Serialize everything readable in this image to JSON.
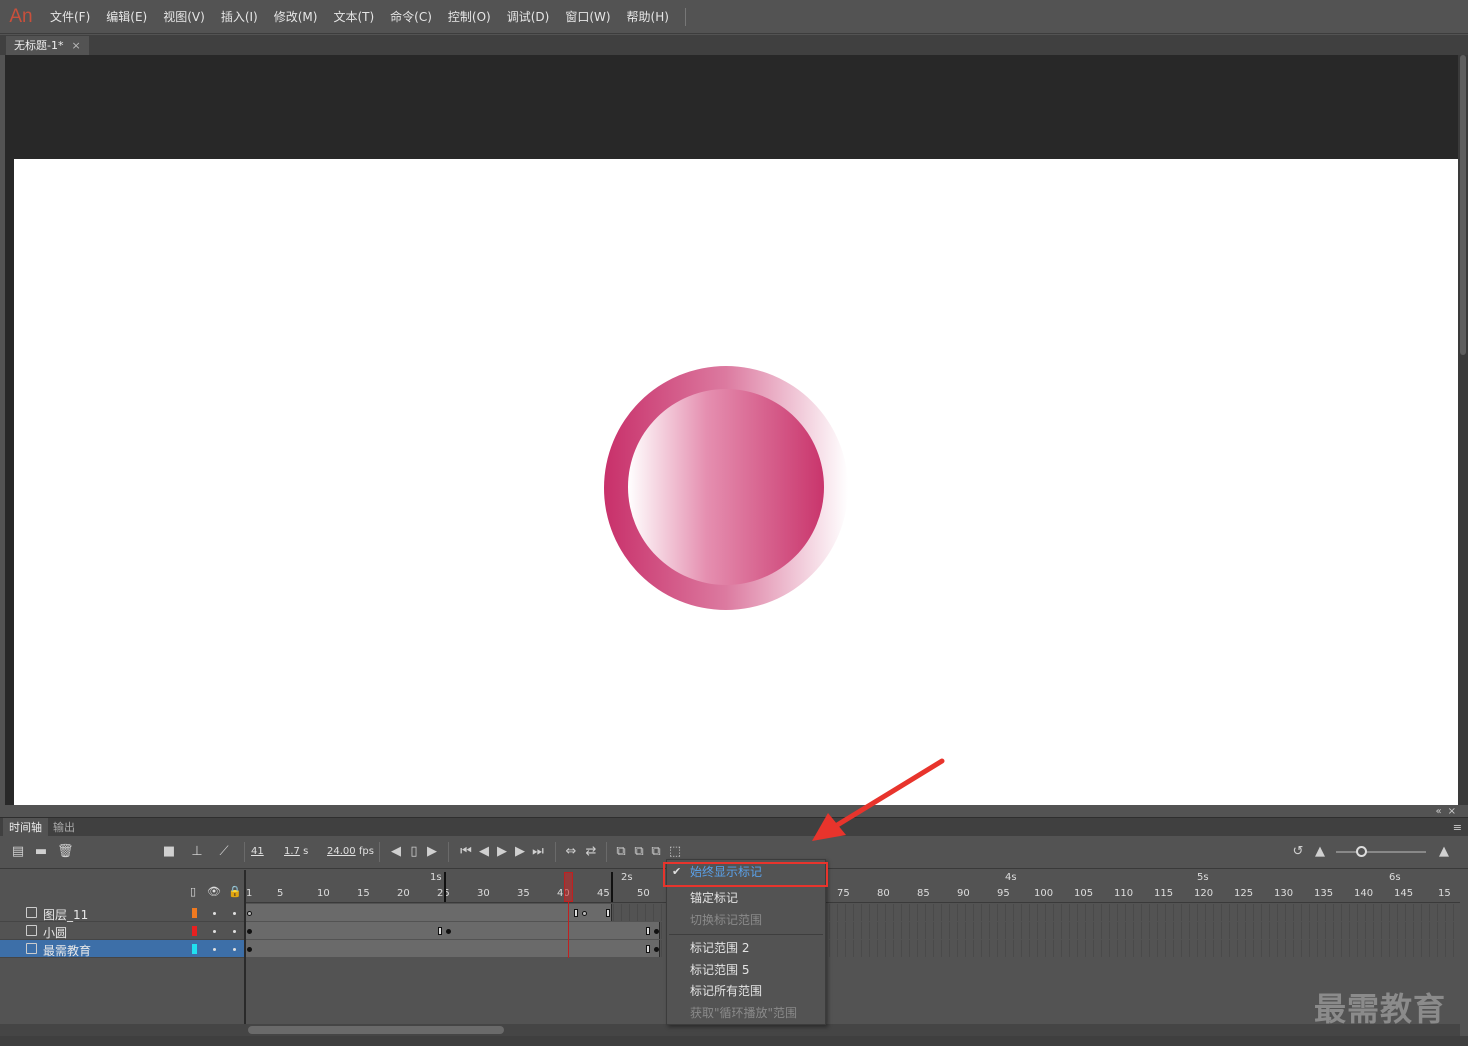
{
  "app": {
    "logo": "An",
    "menu": [
      "文件(F)",
      "编辑(E)",
      "视图(V)",
      "插入(I)",
      "修改(M)",
      "文本(T)",
      "命令(C)",
      "控制(O)",
      "调试(D)",
      "窗口(W)",
      "帮助(H)"
    ],
    "document_tab": "无标题-1*",
    "close_glyph": "×"
  },
  "colors": {
    "ring_gradient": [
      "#c8306a",
      "#dc7aa0",
      "#ffffff"
    ],
    "inner_gradient": [
      "#ffffff",
      "#e58fb0",
      "#c9356c"
    ],
    "highlight": "#e8342c",
    "selected_layer": "#3d6fa8"
  },
  "panels": {
    "tabs": [
      "时间轴",
      "输出"
    ],
    "top_icons": "«×",
    "menu_icon": "≡"
  },
  "toolbar": {
    "current_frame": "41",
    "elapsed_time": "1.7",
    "time_unit": "s",
    "frame_rate": "24.00",
    "fps_unit": "fps",
    "icons": [
      "new-layer-icon",
      "folder-icon",
      "trash-icon",
      "camera-icon",
      "parenting-icon",
      "graph-icon",
      "prev-frame-icon",
      "center-frame-icon",
      "next-frame-icon",
      "first-frame-icon",
      "step-back-icon",
      "play-icon",
      "step-forward-icon",
      "last-frame-icon",
      "loop-icon",
      "onion-skin-icon",
      "onion-outline-icon",
      "edit-multiple-icon",
      "modify-markers-icon",
      "refresh-icon",
      "zoom-small-icon",
      "zoom-large-icon"
    ]
  },
  "layer_header_icons": [
    "outline-icon",
    "eye-icon",
    "lock-icon"
  ],
  "layers": [
    {
      "name": "图层_11",
      "color": "#f07a20"
    },
    {
      "name": "小圆",
      "color": "#e82020"
    },
    {
      "name": "最需教育",
      "color": "#20e0f0"
    }
  ],
  "ruler": {
    "seconds": [
      "1s",
      "2s",
      "4s",
      "5s",
      "6s"
    ],
    "frames": [
      "1",
      "5",
      "10",
      "15",
      "20",
      "25",
      "30",
      "35",
      "40",
      "45",
      "50",
      "75",
      "80",
      "85",
      "90",
      "95",
      "100",
      "105",
      "110",
      "115",
      "120",
      "125",
      "130",
      "135",
      "140",
      "145",
      "15"
    ]
  },
  "context_menu": {
    "items": [
      {
        "label": "始终显示标记",
        "checked": true,
        "disabled": false
      },
      {
        "label": "锚定标记",
        "checked": false,
        "disabled": false
      },
      {
        "label": "切换标记范围",
        "checked": false,
        "disabled": true
      },
      {
        "label": "标记范围 2",
        "checked": false,
        "disabled": false
      },
      {
        "label": "标记范围 5",
        "checked": false,
        "disabled": false
      },
      {
        "label": "标记所有范围",
        "checked": false,
        "disabled": false
      },
      {
        "label": "获取\"循环播放\"范围",
        "checked": false,
        "disabled": true
      }
    ],
    "check_glyph": "✔"
  },
  "watermark": "最需教育"
}
